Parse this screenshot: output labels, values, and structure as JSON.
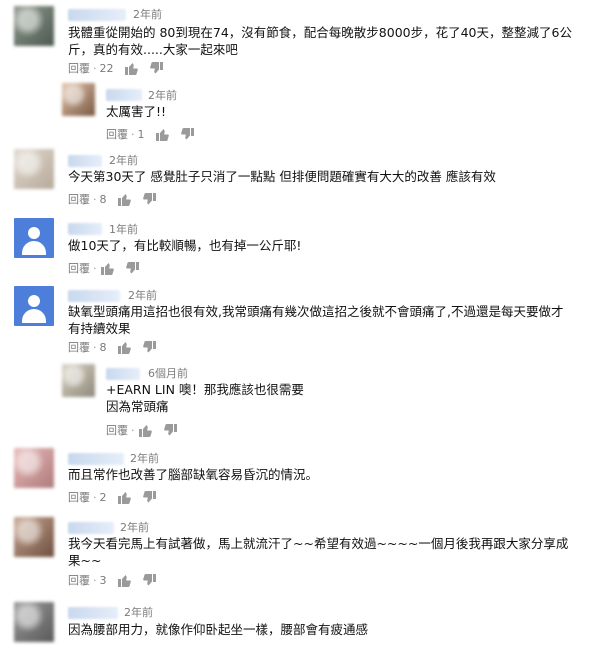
{
  "ui": {
    "reply_label": "回覆",
    "separator": "·"
  },
  "comments": [
    {
      "time": "2年前",
      "text": "我體重從開始的 80到現在74，沒有節食，配合每晚散步8000步，花了40天，整整減了6公斤，真的有效.....大家一起來吧",
      "likes": "22"
    },
    {
      "time": "2年前",
      "text": "太厲害了!!",
      "likes": "1"
    },
    {
      "time": "2年前",
      "text": "今天第30天了  感覺肚子只消了一點點  但排便問題確實有大大的改善  應該有效",
      "likes": "8"
    },
    {
      "time": "1年前",
      "text": "做10天了，有比較順暢，也有掉一公斤耶!",
      "likes": ""
    },
    {
      "time": "2年前",
      "text": "缺氧型頭痛用這招也很有效,我常頭痛有幾次做這招之後就不會頭痛了,不過還是每天要做才有持續效果",
      "likes": "8"
    },
    {
      "time": "6個月前",
      "text": "+EARN LIN 噢！那我應該也很需要\n因為常頭痛",
      "likes": ""
    },
    {
      "time": "2年前",
      "text": "而且常作也改善了腦部缺氧容易昏沉的情況。",
      "likes": "2"
    },
    {
      "time": "2年前",
      "text": "我今天看完馬上有試著做，馬上就流汗了~~希望有效過~~~~一個月後我再跟大家分享成果~~",
      "likes": "3"
    },
    {
      "time": "2年前",
      "text": "因為腰部用力，就像作仰卧起坐一樣，腰部會有疲通感",
      "likes": ""
    }
  ],
  "icons": [
    "thumb-up-icon",
    "thumb-down-icon"
  ]
}
